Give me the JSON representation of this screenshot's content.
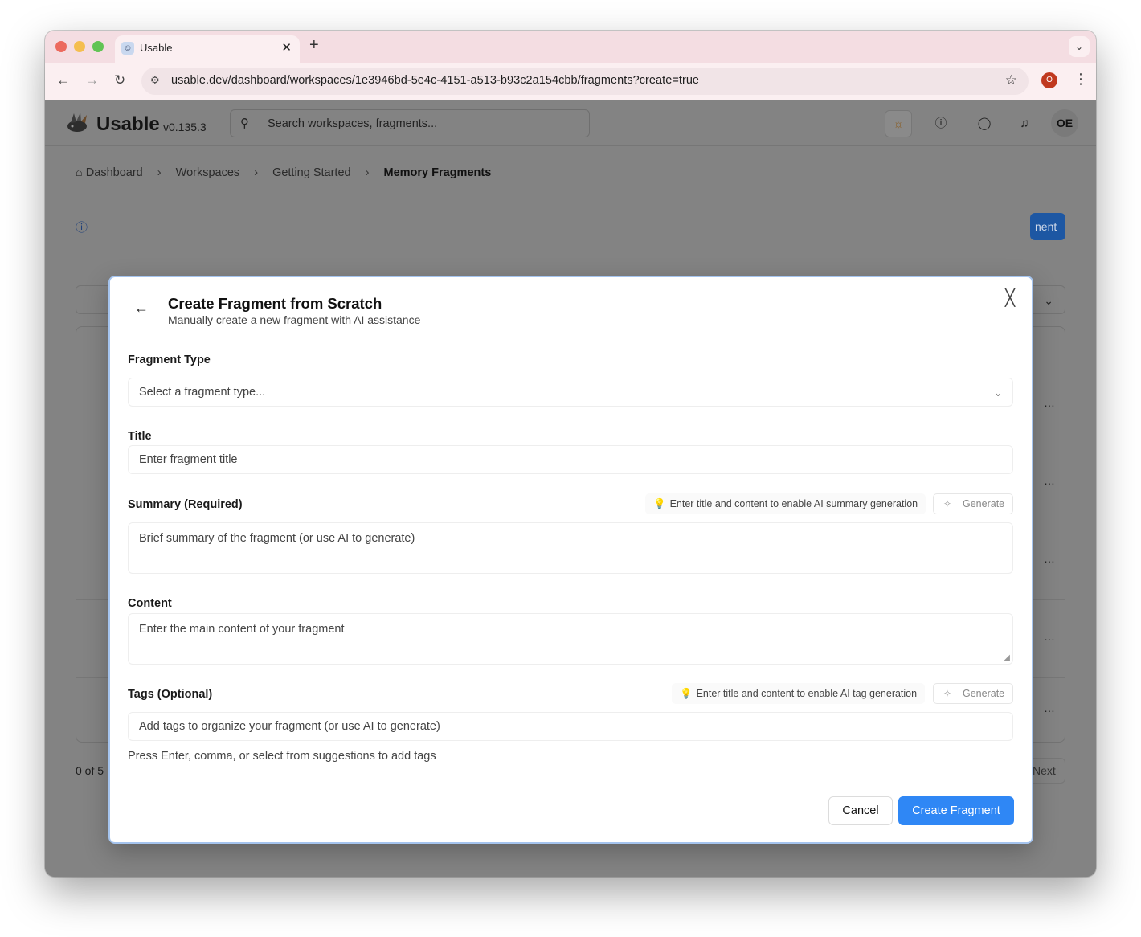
{
  "browser": {
    "tab_title": "Usable",
    "url": "usable.dev/dashboard/workspaces/1e3946bd-5e4c-4151-a513-b93c2a154cbb/fragments?create=true",
    "profile_initial": "O"
  },
  "app": {
    "logo": "Usable",
    "version": "v0.135.3",
    "search_placeholder": "Search workspaces, fragments...",
    "avatar_initials": "OE",
    "breadcrumb": [
      "Dashboard",
      "Workspaces",
      "Getting Started",
      "Memory Fragments"
    ],
    "bg_button_text": "nent",
    "footer_left": "0 of 5",
    "footer_right": "Next"
  },
  "modal": {
    "title": "Create Fragment from Scratch",
    "subtitle": "Manually create a new fragment with AI assistance",
    "fragment_type": {
      "label": "Fragment Type",
      "placeholder": "Select a fragment type..."
    },
    "title_field": {
      "label": "Title",
      "placeholder": "Enter fragment title"
    },
    "summary": {
      "label": "Summary (Required)",
      "hint": "Enter title and content to enable AI summary generation",
      "generate": "Generate",
      "placeholder": "Brief summary of the fragment (or use AI to generate)"
    },
    "content": {
      "label": "Content",
      "placeholder": "Enter the main content of your fragment"
    },
    "tags": {
      "label": "Tags (Optional)",
      "hint": "Enter title and content to enable AI tag generation",
      "generate": "Generate",
      "placeholder": "Add tags to organize your fragment (or use AI to generate)",
      "help": "Press Enter, comma, or select from suggestions to add tags"
    },
    "cancel": "Cancel",
    "create": "Create Fragment"
  },
  "colors": {
    "primary_button": "#2f87f5",
    "overlay": "#838383",
    "modal_border": "#a5c4ee",
    "tab_bar": "#f4dde2"
  }
}
